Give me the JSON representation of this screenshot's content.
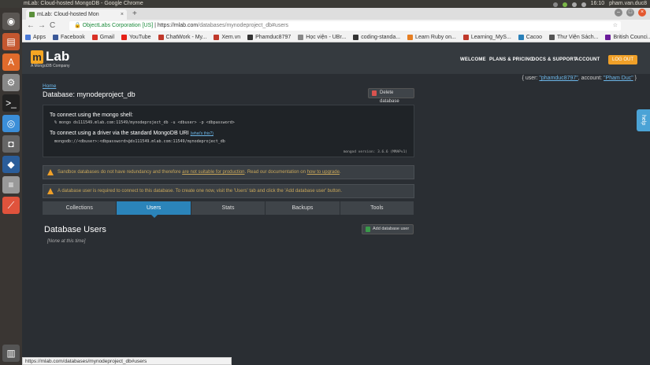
{
  "os": {
    "window_title": "mLab: Cloud-hosted MongoDB - Google Chrome",
    "time": "16:10",
    "user": "pham.van.duc8"
  },
  "browser": {
    "tab_title": "mLab: Cloud-hosted Mon",
    "tab_close": "×",
    "new_tab": "+",
    "back": "←",
    "forward": "→",
    "reload": "C",
    "lock": "🔒",
    "org": "ObjectLabs Corporation [US]",
    "url_host": "https://mlab.com",
    "url_path": "/databases/mynodeproject_db#users",
    "star": "☆",
    "bookmarks": [
      {
        "label": "Apps",
        "color": "#4a7ad8"
      },
      {
        "label": "Facebook",
        "color": "#3b5998"
      },
      {
        "label": "Gmail",
        "color": "#d93025"
      },
      {
        "label": "YouTube",
        "color": "#e62117"
      },
      {
        "label": "ChatWork - My...",
        "color": "#c0392b"
      },
      {
        "label": "Xem.vn",
        "color": "#c0392b"
      },
      {
        "label": "Phamduc8797",
        "color": "#333333"
      },
      {
        "label": "Học viện - UBr...",
        "color": "#888888"
      },
      {
        "label": "coding-standa...",
        "color": "#333333"
      },
      {
        "label": "Learn Ruby on...",
        "color": "#e67e22"
      },
      {
        "label": "Learning_MyS...",
        "color": "#c0392b"
      },
      {
        "label": "Cacoo",
        "color": "#2980b9"
      },
      {
        "label": "Thư Viện Sách...",
        "color": "#555555"
      },
      {
        "label": "British Counci...",
        "color": "#6a1b9a"
      }
    ],
    "status_url": "https://mlab.com/databases/mynodeproject_db#users"
  },
  "header": {
    "logo_letter": "m",
    "logo_text": "Lab",
    "logo_sub": "A MongoDB Company",
    "nav": [
      "WELCOME",
      "PLANS & PRICING",
      "DOCS & SUPPORT",
      "ACCOUNT"
    ],
    "logout": "LOG OUT"
  },
  "account": {
    "prefix": "{ user: ",
    "user": "\"phamduc8797\"",
    "middle": ", account: ",
    "account": "\"Pham Duc\"",
    "suffix": " }"
  },
  "db": {
    "breadcrumb": "Home",
    "title": "Database: mynodeproject_db",
    "delete_button": "Delete database",
    "shell_label": "To connect using the mongo shell:",
    "shell_cmd": "% mongo ds111549.mlab.com:11549/mynodeproject_db -u <dbuser> -p <dbpassword>",
    "driver_label": "To connect using a driver via the standard MongoDB URI",
    "whats_this": "(what's this?)",
    "driver_uri": "mongodb://<dbuser>:<dbpassword>@ds111549.mlab.com:11549/mynodeproject_db",
    "version": "mongod version: 3.6.6 (MMAPv1)"
  },
  "warnings": {
    "w1_a": "Sandbox databases do not have redundancy and therefore ",
    "w1_link1": "are not suitable for production",
    "w1_b": ". Read our documentation on ",
    "w1_link2": "how to upgrade",
    "w1_c": ".",
    "w2": "A database user is required to connect to this database. To create one now, visit the 'Users' tab and click the 'Add database user' button."
  },
  "tabs": [
    "Collections",
    "Users",
    "Stats",
    "Backups",
    "Tools"
  ],
  "users": {
    "heading": "Database Users",
    "add_button": "Add database user",
    "empty": "[None at this time]"
  },
  "help": "help"
}
